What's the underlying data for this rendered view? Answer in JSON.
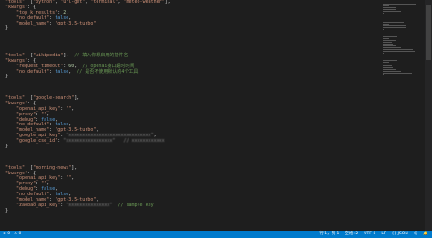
{
  "editor": {
    "lines": [
      [
        {
          "t": "\"tools\"",
          "c": "key"
        },
        {
          "t": ": [",
          "c": "pun"
        },
        {
          "t": "\"python\"",
          "c": "str"
        },
        {
          "t": ", ",
          "c": "pun"
        },
        {
          "t": "\"url-get\"",
          "c": "str"
        },
        {
          "t": ", ",
          "c": "pun"
        },
        {
          "t": "\"terminal\"",
          "c": "str"
        },
        {
          "t": ", ",
          "c": "pun"
        },
        {
          "t": "\"meteo-weather\"",
          "c": "str"
        },
        {
          "t": "],",
          "c": "pun"
        }
      ],
      [
        {
          "t": "\"kwargs\"",
          "c": "key"
        },
        {
          "t": ": {",
          "c": "pun"
        }
      ],
      [
        {
          "t": "    \"top_k_results\"",
          "c": "key"
        },
        {
          "t": ": ",
          "c": "pun"
        },
        {
          "t": "2",
          "c": "num"
        },
        {
          "t": ",",
          "c": "pun"
        }
      ],
      [
        {
          "t": "    \"no_default\"",
          "c": "key"
        },
        {
          "t": ": ",
          "c": "pun"
        },
        {
          "t": "false",
          "c": "kw"
        },
        {
          "t": ",",
          "c": "pun"
        }
      ],
      [
        {
          "t": "    \"model_name\"",
          "c": "key"
        },
        {
          "t": ": ",
          "c": "pun"
        },
        {
          "t": "\"gpt-3.5-turbo\"",
          "c": "str"
        }
      ],
      [
        {
          "t": "}",
          "c": "pun"
        }
      ],
      [
        {
          "t": "",
          "c": "pun"
        }
      ],
      [
        {
          "t": "",
          "c": "pun"
        }
      ],
      [
        {
          "t": "",
          "c": "pun"
        }
      ],
      [
        {
          "t": "",
          "c": "pun"
        }
      ],
      [
        {
          "t": "\"tools\"",
          "c": "key"
        },
        {
          "t": ": [",
          "c": "pun"
        },
        {
          "t": "\"wikipedia\"",
          "c": "str"
        },
        {
          "t": "],  ",
          "c": "pun"
        },
        {
          "t": "// 填入你想启用的插件名",
          "c": "cmt"
        }
      ],
      [
        {
          "t": "\"kwargs\"",
          "c": "key"
        },
        {
          "t": ": {",
          "c": "pun"
        }
      ],
      [
        {
          "t": "    \"request_timeout\"",
          "c": "key"
        },
        {
          "t": ": ",
          "c": "pun"
        },
        {
          "t": "60",
          "c": "num"
        },
        {
          "t": ",  ",
          "c": "pun"
        },
        {
          "t": "// openai接口超时时间",
          "c": "cmt"
        }
      ],
      [
        {
          "t": "    \"no_default\"",
          "c": "key"
        },
        {
          "t": ": ",
          "c": "pun"
        },
        {
          "t": "false",
          "c": "kw"
        },
        {
          "t": ",  ",
          "c": "pun"
        },
        {
          "t": "// 是否不使用默认的4个工具",
          "c": "cmt"
        }
      ],
      [
        {
          "t": "}",
          "c": "pun"
        }
      ],
      [
        {
          "t": "",
          "c": "pun"
        }
      ],
      [
        {
          "t": "",
          "c": "pun"
        }
      ],
      [
        {
          "t": "",
          "c": "pun"
        }
      ],
      [
        {
          "t": "\"tools\"",
          "c": "key"
        },
        {
          "t": ": [",
          "c": "pun"
        },
        {
          "t": "\"google-search\"",
          "c": "str"
        },
        {
          "t": "],",
          "c": "pun"
        }
      ],
      [
        {
          "t": "\"kwargs\"",
          "c": "key"
        },
        {
          "t": ": {",
          "c": "pun"
        }
      ],
      [
        {
          "t": "    \"openai_api_key\"",
          "c": "key"
        },
        {
          "t": ": ",
          "c": "pun"
        },
        {
          "t": "\"\"",
          "c": "str"
        },
        {
          "t": ",",
          "c": "pun"
        }
      ],
      [
        {
          "t": "    \"proxy\"",
          "c": "key"
        },
        {
          "t": ": ",
          "c": "pun"
        },
        {
          "t": "\"\"",
          "c": "str"
        },
        {
          "t": ",",
          "c": "pun"
        }
      ],
      [
        {
          "t": "    \"debug\"",
          "c": "key"
        },
        {
          "t": ": ",
          "c": "pun"
        },
        {
          "t": "false",
          "c": "kw"
        },
        {
          "t": ",",
          "c": "pun"
        }
      ],
      [
        {
          "t": "    \"no_default\"",
          "c": "key"
        },
        {
          "t": ": ",
          "c": "pun"
        },
        {
          "t": "false",
          "c": "kw"
        },
        {
          "t": ",",
          "c": "pun"
        }
      ],
      [
        {
          "t": "    \"model_name\"",
          "c": "key"
        },
        {
          "t": ": ",
          "c": "pun"
        },
        {
          "t": "\"gpt-3.5-turbo\"",
          "c": "str"
        },
        {
          "t": ",",
          "c": "pun"
        }
      ],
      [
        {
          "t": "    \"google_api_key\"",
          "c": "key"
        },
        {
          "t": ": ",
          "c": "pun"
        },
        {
          "t": "\"xxxxxxxxxxxxxxxxxxxxxxxxxxxxxx\"",
          "c": "blur"
        },
        {
          "t": ",",
          "c": "pun"
        }
      ],
      [
        {
          "t": "    \"google_cse_id\"",
          "c": "key"
        },
        {
          "t": ": ",
          "c": "pun"
        },
        {
          "t": "\"xxxxxxxxxxxxxxxxx\"",
          "c": "blur"
        },
        {
          "t": "   ",
          "c": "pun"
        },
        {
          "t": "// xxxxxxxxxxxx",
          "c": "blur"
        }
      ],
      [
        {
          "t": "}",
          "c": "pun"
        }
      ],
      [
        {
          "t": "",
          "c": "pun"
        }
      ],
      [
        {
          "t": "",
          "c": "pun"
        }
      ],
      [
        {
          "t": "",
          "c": "pun"
        }
      ],
      [
        {
          "t": "\"tools\"",
          "c": "key"
        },
        {
          "t": ": [",
          "c": "pun"
        },
        {
          "t": "\"morning-news\"",
          "c": "str"
        },
        {
          "t": "],",
          "c": "pun"
        }
      ],
      [
        {
          "t": "\"kwargs\"",
          "c": "key"
        },
        {
          "t": ": {",
          "c": "pun"
        }
      ],
      [
        {
          "t": "    \"openai_api_key\"",
          "c": "key"
        },
        {
          "t": ": ",
          "c": "pun"
        },
        {
          "t": "\"\"",
          "c": "str"
        },
        {
          "t": ",",
          "c": "pun"
        }
      ],
      [
        {
          "t": "    \"proxy\"",
          "c": "key"
        },
        {
          "t": ": ",
          "c": "pun"
        },
        {
          "t": "\"\"",
          "c": "str"
        },
        {
          "t": ",",
          "c": "pun"
        }
      ],
      [
        {
          "t": "    \"debug\"",
          "c": "key"
        },
        {
          "t": ": ",
          "c": "pun"
        },
        {
          "t": "false",
          "c": "kw"
        },
        {
          "t": ",",
          "c": "pun"
        }
      ],
      [
        {
          "t": "    \"no_default\"",
          "c": "key"
        },
        {
          "t": ": ",
          "c": "pun"
        },
        {
          "t": "false",
          "c": "kw"
        },
        {
          "t": ",",
          "c": "pun"
        }
      ],
      [
        {
          "t": "    \"model_name\"",
          "c": "key"
        },
        {
          "t": ": ",
          "c": "pun"
        },
        {
          "t": "\"gpt-3.5-turbo\"",
          "c": "str"
        },
        {
          "t": ",",
          "c": "pun"
        }
      ],
      [
        {
          "t": "    \"zaobao_api_key\"",
          "c": "key"
        },
        {
          "t": ": ",
          "c": "pun"
        },
        {
          "t": "\"xxxxxxxxxxxxxxx\"",
          "c": "blur"
        },
        {
          "t": "  ",
          "c": "pun"
        },
        {
          "t": "// sample key",
          "c": "cmt"
        }
      ],
      [
        {
          "t": "}",
          "c": "pun"
        }
      ]
    ]
  },
  "statusbar": {
    "left": [
      "⊗ 0",
      "⚠ 0"
    ],
    "right": [
      "行 1，列 1",
      "空格: 2",
      "UTF-8",
      "LF",
      "{} JSON",
      "☺",
      "🔔"
    ]
  },
  "colors": {
    "statusbar": "#007acc",
    "editor_bg": "#1e1e1e"
  }
}
